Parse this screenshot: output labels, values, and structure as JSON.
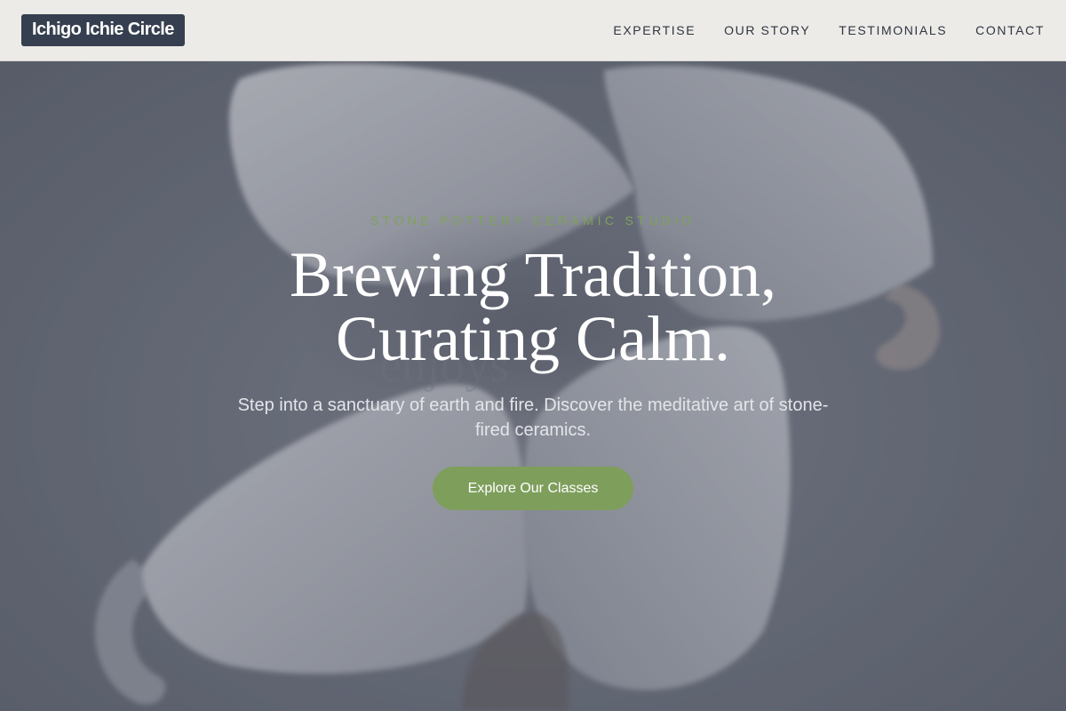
{
  "brand": {
    "name": "Ichigo Ichie Circle"
  },
  "nav": {
    "items": [
      {
        "label": "EXPERTISE"
      },
      {
        "label": "OUR STORY"
      },
      {
        "label": "TESTIMONIALS"
      },
      {
        "label": "CONTACT"
      }
    ]
  },
  "hero": {
    "eyebrow": "STONE POTTERY CERAMIC STUDIO",
    "headline_line1": "Brewing Tradition,",
    "headline_line2": "Curating Calm.",
    "subtitle": "Step into a sanctuary of earth and fire. Discover the meditative art of stone-fired ceramics.",
    "cta_label": "Explore Our Classes"
  },
  "colors": {
    "header_bg": "#ecebe7",
    "logo_bg": "#363f4f",
    "accent_green": "#7e9f5c",
    "eyebrow_green": "#7ea25a",
    "hero_overlay": "#5f6470"
  }
}
